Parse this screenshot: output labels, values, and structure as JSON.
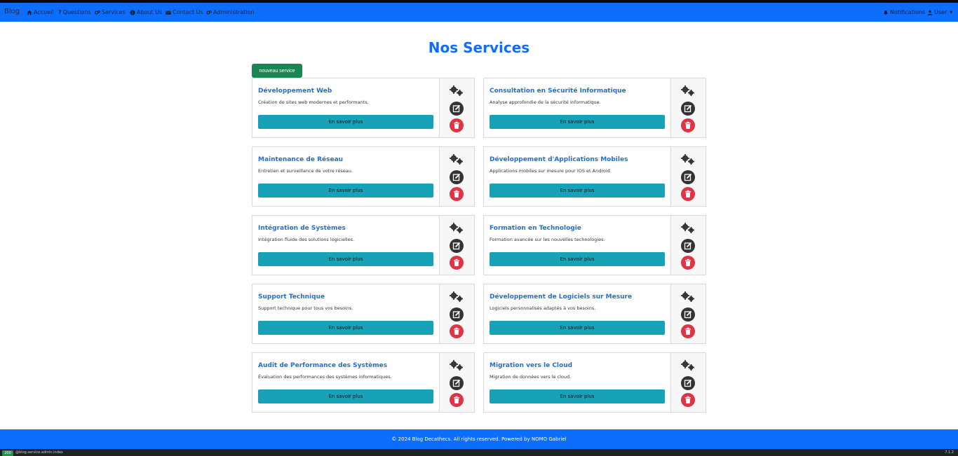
{
  "navbar": {
    "brand": "Blog",
    "items": [
      {
        "label": "Accueil",
        "icon": "home-icon"
      },
      {
        "label": "Questions",
        "icon": "question-icon"
      },
      {
        "label": "Services",
        "icon": "cogs-icon"
      },
      {
        "label": "About Us",
        "icon": "info-icon"
      },
      {
        "label": "Contact Us",
        "icon": "envelope-icon"
      },
      {
        "label": "Administration",
        "icon": "cogs-icon"
      }
    ],
    "notifications": "Notifications",
    "user": "User"
  },
  "page": {
    "title": "Nos Services",
    "new_button": "nouveau service"
  },
  "services": [
    {
      "title": "Développement Web",
      "description": "Création de sites web modernes et performants.",
      "button": "En savoir plus"
    },
    {
      "title": "Consultation en Sécurité Informatique",
      "description": "Analyse approfondie de la sécurité informatique.",
      "button": "En savoir plus"
    },
    {
      "title": "Maintenance de Réseau",
      "description": "Entretien et surveillance de votre réseau.",
      "button": "En savoir plus"
    },
    {
      "title": "Développement d'Applications Mobiles",
      "description": "Applications mobiles sur mesure pour iOS et Android.",
      "button": "En savoir plus"
    },
    {
      "title": "Intégration de Systèmes",
      "description": "Intégration fluide des solutions logicielles.",
      "button": "En savoir plus"
    },
    {
      "title": "Formation en Technologie",
      "description": "Formation avancée sur les nouvelles technologies.",
      "button": "En savoir plus"
    },
    {
      "title": "Support Technique",
      "description": "Support technique pour tous vos besoins.",
      "button": "En savoir plus"
    },
    {
      "title": "Développement de Logiciels sur Mesure",
      "description": "Logiciels personnalisés adaptés à vos besoins.",
      "button": "En savoir plus"
    },
    {
      "title": "Audit de Performance des Systèmes",
      "description": "Évaluation des performances des systèmes informatiques.",
      "button": "En savoir plus"
    },
    {
      "title": "Migration vers le Cloud",
      "description": "Migration de données vers le cloud.",
      "button": "En savoir plus"
    }
  ],
  "footer": {
    "text": "© 2024 Blog Decathecs. All rights reserved. Powered by NOMO Gabriel"
  },
  "statusbar": {
    "code": "200",
    "route": "@blog.service.admin.index",
    "right": "7.1.2"
  },
  "colors": {
    "primary": "#0d6efd",
    "success": "#198754",
    "info": "#17a2b8",
    "danger": "#dc3545",
    "dark": "#333333"
  }
}
